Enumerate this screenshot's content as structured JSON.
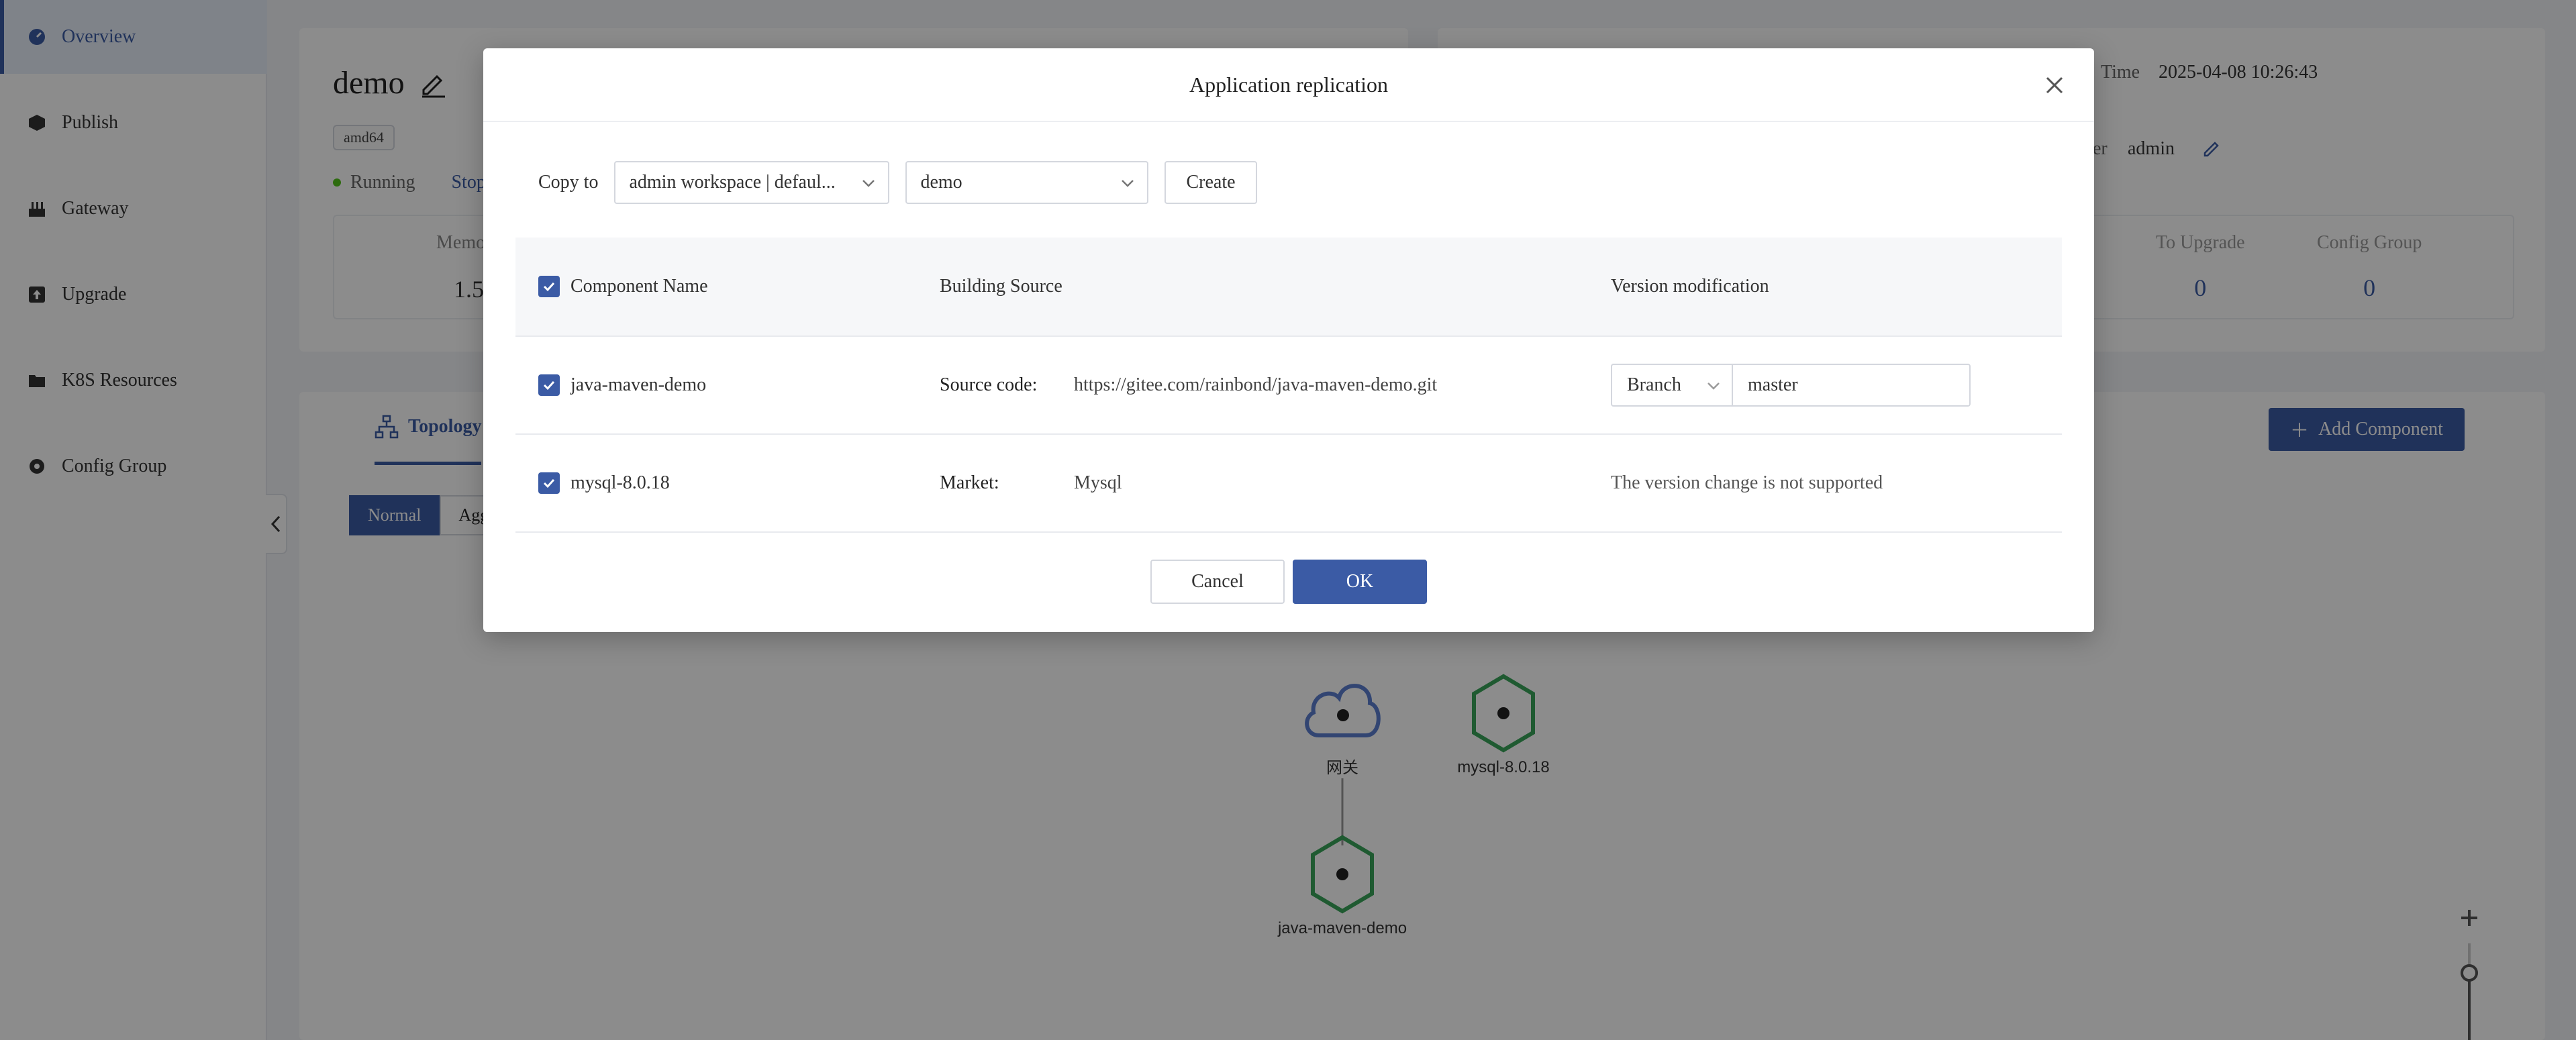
{
  "sidebar": {
    "items": [
      {
        "label": "Overview",
        "icon": "dashboard-icon",
        "active": true
      },
      {
        "label": "Publish",
        "icon": "cube-icon"
      },
      {
        "label": "Gateway",
        "icon": "gateway-icon"
      },
      {
        "label": "Upgrade",
        "icon": "upgrade-icon"
      },
      {
        "label": "K8S Resources",
        "icon": "folder-icon"
      },
      {
        "label": "Config Group",
        "icon": "gear-icon"
      }
    ]
  },
  "app": {
    "name": "demo",
    "arch": "amd64",
    "status": "Running",
    "stop_label": "Stop",
    "memory_label": "Memo",
    "memory_value": "1.5",
    "time_label": "Time",
    "time_value": "2025-04-08 10:26:43",
    "owner_label": "er",
    "owner_value": "admin",
    "to_upgrade_label": "To Upgrade",
    "to_upgrade_value": "0",
    "config_group_label": "Config Group",
    "config_group_value": "0",
    "topology_tab": "Topology",
    "mode_normal": "Normal",
    "mode_agg": "Agg",
    "add_component": "Add Component"
  },
  "topology": {
    "nodes": [
      {
        "label": "网关",
        "kind": "gateway-cloud-icon"
      },
      {
        "label": "mysql-8.0.18",
        "kind": "component-hexagon-icon"
      },
      {
        "label": "java-maven-demo",
        "kind": "component-hexagon-icon"
      }
    ]
  },
  "modal": {
    "title": "Application replication",
    "copy_to_label": "Copy to",
    "workspace_value": "admin workspace | defaul...",
    "app_value": "demo",
    "create_label": "Create",
    "table": {
      "headers": [
        "Component Name",
        "Building Source",
        "Version modification"
      ],
      "rows": [
        {
          "name": "java-maven-demo",
          "source_label": "Source code:",
          "source_value": "https://gitee.com/rainbond/java-maven-demo.git",
          "version_type": "Branch",
          "version_value": "master"
        },
        {
          "name": "mysql-8.0.18",
          "source_label": "Market:",
          "source_value": "Mysql",
          "version_note": "The version change is not supported"
        }
      ]
    },
    "cancel_label": "Cancel",
    "ok_label": "OK"
  },
  "colors": {
    "accent": "#3b5ba5",
    "running": "#52c41a",
    "hexagon": "#3aa55a"
  }
}
